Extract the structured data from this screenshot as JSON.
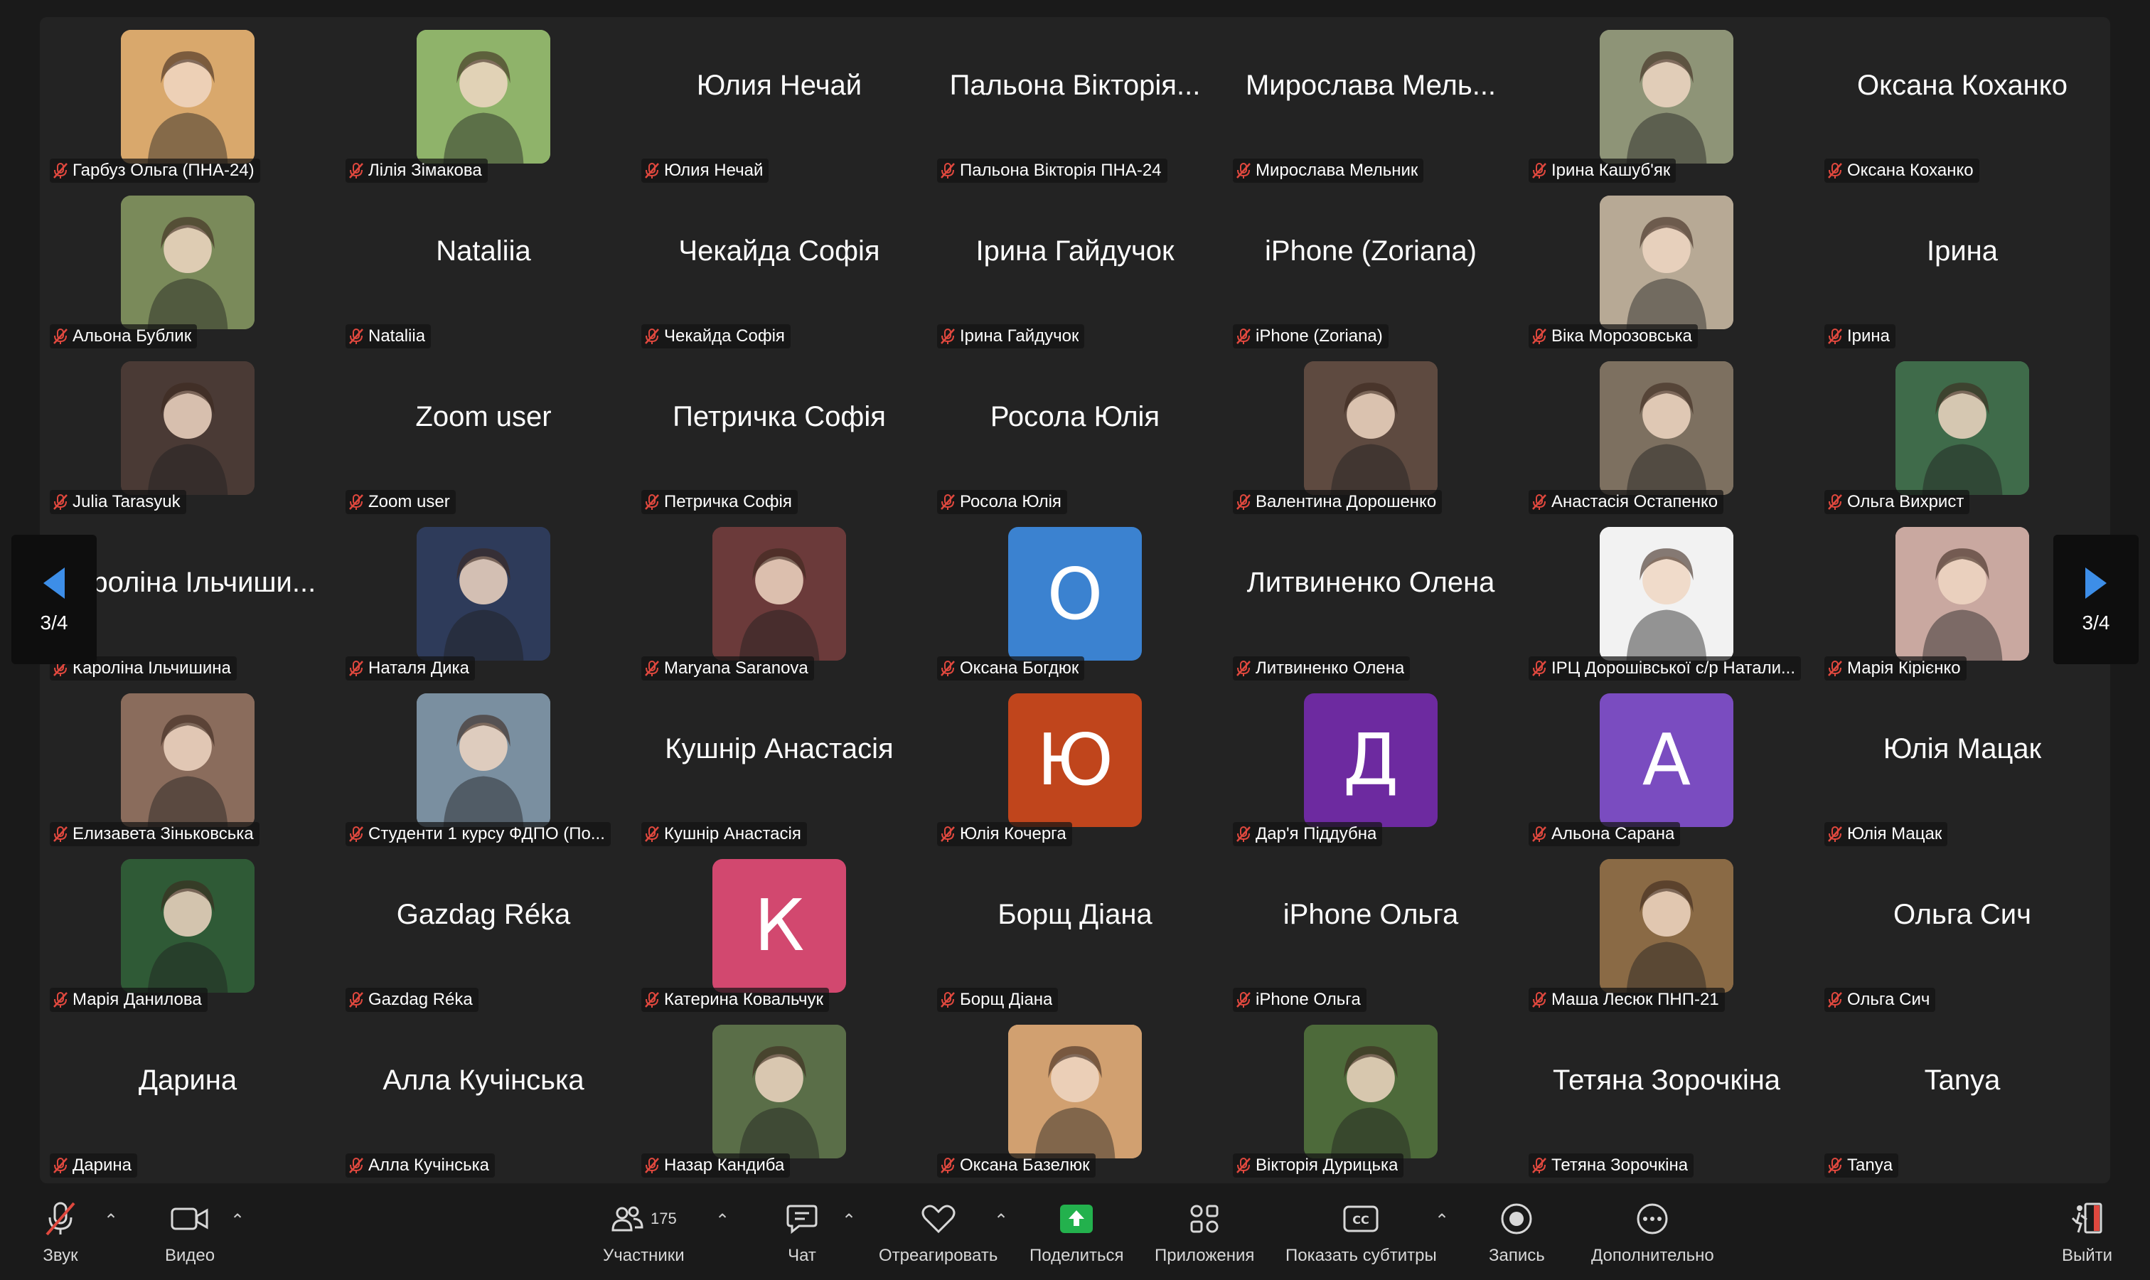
{
  "participants": [
    {
      "name": "Гарбуз Ольга (ПНА-24)",
      "type": "photo",
      "color": "#d9a86c"
    },
    {
      "name": "Лілія Зімакова",
      "type": "photo",
      "color": "#8fb36a"
    },
    {
      "name": "Юлия Нечай",
      "type": "text",
      "display": "Юлия Нечай"
    },
    {
      "name": "Пальона Вікторія ПНА-24",
      "type": "text",
      "display": "Пальона Вікторія..."
    },
    {
      "name": "Мирослава Мельник",
      "type": "text",
      "display": "Мирослава Мель..."
    },
    {
      "name": "Ірина Кашуб'як",
      "type": "photo",
      "color": "#8e9477"
    },
    {
      "name": "Оксана Коханко",
      "type": "text",
      "display": "Оксана Коханко"
    },
    {
      "name": "Альона Бублик",
      "type": "photo",
      "color": "#7a8a5a"
    },
    {
      "name": "Nataliia",
      "type": "text",
      "display": "Nataliia"
    },
    {
      "name": "Чекайда Софія",
      "type": "text",
      "display": "Чекайда Софія"
    },
    {
      "name": "Ірина Гайдучок",
      "type": "text",
      "display": "Ірина Гайдучок"
    },
    {
      "name": "iPhone (Zoriana)",
      "type": "text",
      "display": "iPhone (Zoriana)"
    },
    {
      "name": "Віка Морозовська",
      "type": "photo",
      "color": "#b7a995"
    },
    {
      "name": "Ірина",
      "type": "text",
      "display": "Ірина"
    },
    {
      "name": "Julia Tarasyuk",
      "type": "photo",
      "color": "#4a3a35"
    },
    {
      "name": "Zoom user",
      "type": "text",
      "display": "Zoom user"
    },
    {
      "name": "Петричка Софія",
      "type": "text",
      "display": "Петричка Софія"
    },
    {
      "name": "Росола Юлія",
      "type": "text",
      "display": "Росола Юлія"
    },
    {
      "name": "Валентина Дорошенко",
      "type": "photo",
      "color": "#5e4a40"
    },
    {
      "name": "Анастасія Остапенко",
      "type": "photo",
      "color": "#7d7060"
    },
    {
      "name": "Ольга Вихрист",
      "type": "photo",
      "color": "#3f6b4a"
    },
    {
      "name": "Кароліна Ільчишина",
      "type": "text",
      "display": "Кароліна Ільчиши..."
    },
    {
      "name": "Наталя Дика",
      "type": "photo",
      "color": "#2e3b5a"
    },
    {
      "name": "Maryana Saranova",
      "type": "photo",
      "color": "#6b3a3a"
    },
    {
      "name": "Оксана Богдюк",
      "type": "letter",
      "letter": "О",
      "color": "#3b82d0"
    },
    {
      "name": "Литвиненко Олена",
      "type": "text",
      "display": "Литвиненко Олена"
    },
    {
      "name": "ІРЦ Дорошівської с/р Натали...",
      "type": "photo",
      "color": "#f2f2f2"
    },
    {
      "name": "Марія Кірієнко",
      "type": "photo",
      "color": "#c9a8a0"
    },
    {
      "name": "Елизавета Зіньковська",
      "type": "photo",
      "color": "#8a6c5c"
    },
    {
      "name": "Студенти 1 курсу ФДПО (По...",
      "type": "photo",
      "color": "#7a8fa0"
    },
    {
      "name": "Кушнір Анастасія",
      "type": "text",
      "display": "Кушнір Анастасія"
    },
    {
      "name": "Юлія Кочерга",
      "type": "letter",
      "letter": "Ю",
      "color": "#c0451c"
    },
    {
      "name": "Дар'я Піддубна",
      "type": "letter",
      "letter": "Д",
      "color": "#6d2aa0"
    },
    {
      "name": "Альона Сарана",
      "type": "letter",
      "letter": "А",
      "color": "#7a4cc0"
    },
    {
      "name": "Юлія Мацак",
      "type": "text",
      "display": "Юлія Мацак"
    },
    {
      "name": "Марія Данилова",
      "type": "photo",
      "color": "#2f5a36"
    },
    {
      "name": "Gazdag Réka",
      "type": "text",
      "display": "Gazdag Réka"
    },
    {
      "name": "Катерина Ковальчук",
      "type": "letter",
      "letter": "К",
      "color": "#d2486f"
    },
    {
      "name": "Борщ Діана",
      "type": "text",
      "display": "Борщ Діана"
    },
    {
      "name": "iPhone Ольга",
      "type": "text",
      "display": "iPhone Ольга"
    },
    {
      "name": "Маша  Лесюк ПНП-21",
      "type": "photo",
      "color": "#8a6a45"
    },
    {
      "name": "Ольга Сич",
      "type": "text",
      "display": "Ольга Сич"
    },
    {
      "name": "Дарина",
      "type": "text",
      "display": "Дарина"
    },
    {
      "name": "Алла Кучінська",
      "type": "text",
      "display": "Алла Кучінська"
    },
    {
      "name": "Назар Кандиба",
      "type": "photo",
      "color": "#5a6e48"
    },
    {
      "name": "Оксана Базелюк",
      "type": "photo",
      "color": "#d1a070"
    },
    {
      "name": "Вікторія Дурицька",
      "type": "photo",
      "color": "#4d6a3a"
    },
    {
      "name": "Тетяна Зорочкіна",
      "type": "text",
      "display": "Тетяна Зорочкіна"
    },
    {
      "name": "Tanya",
      "type": "text",
      "display": "Tanya"
    }
  ],
  "pager": {
    "left_page": "3/4",
    "right_page": "3/4"
  },
  "toolbar": {
    "sound": "Звук",
    "video": "Видео",
    "participants": "Участники",
    "participants_count": "175",
    "chat": "Чат",
    "react": "Отреагировать",
    "share": "Поделиться",
    "apps": "Приложения",
    "captions": "Показать субтитры",
    "record": "Запись",
    "more": "Дополнительно",
    "leave": "Выйти"
  },
  "colors": {
    "share_green": "#23b14d",
    "mute_red": "#e0483e",
    "pager_arrow": "#3d8ee8"
  }
}
